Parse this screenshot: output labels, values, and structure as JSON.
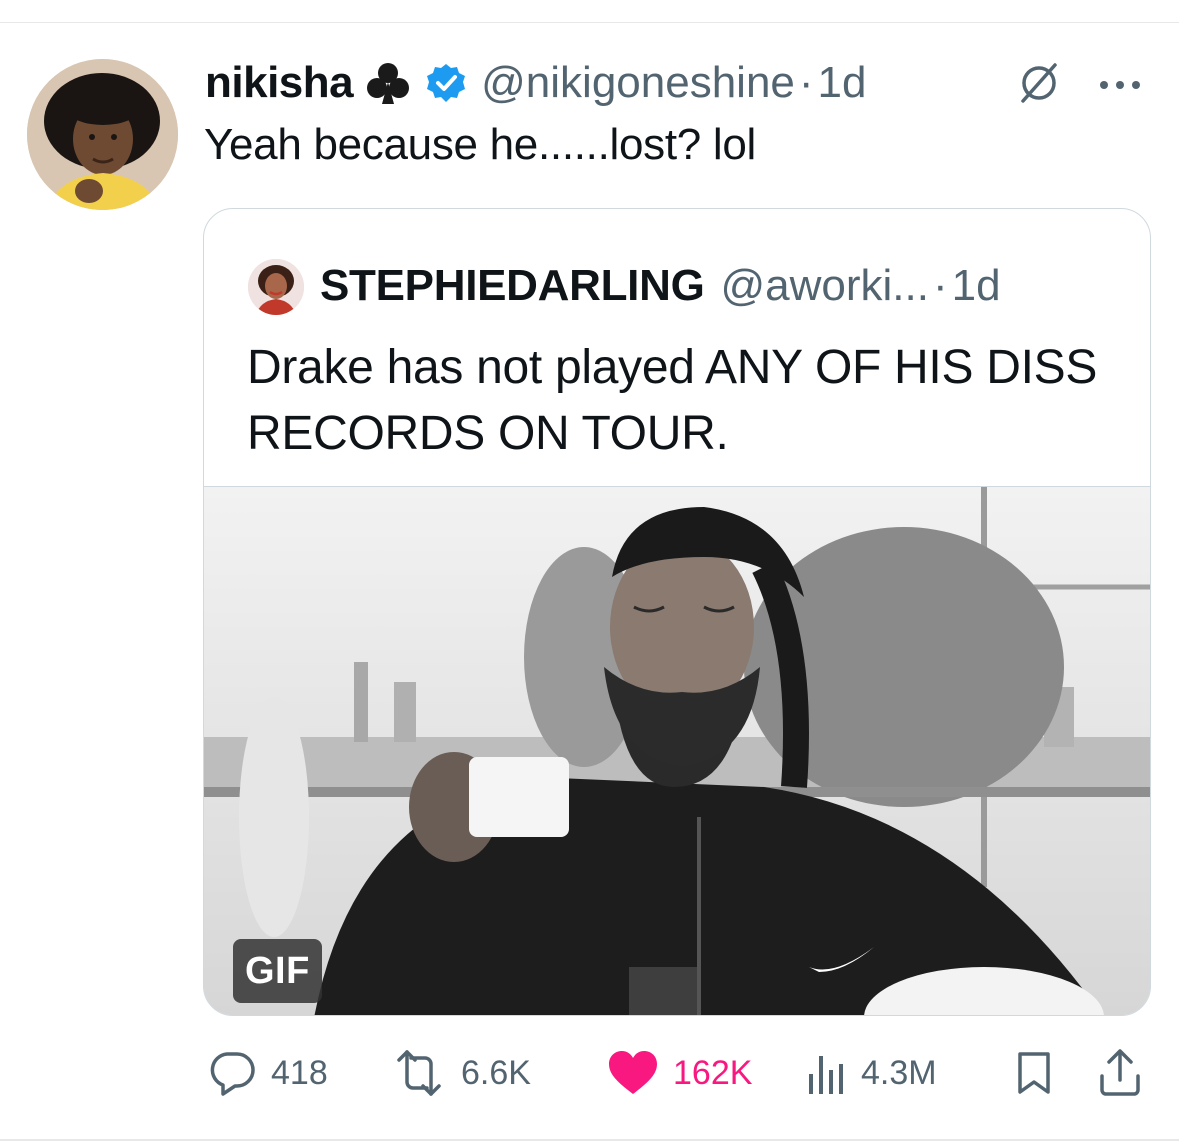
{
  "tweet": {
    "display_name": "nikisha",
    "handle": "@nikigoneshine",
    "separator": "·",
    "time": "1d",
    "text": "Yeah because he......lost? lol",
    "icons": [
      "club-icon",
      "verified-badge-icon",
      "grok-icon",
      "more-icon"
    ]
  },
  "quote": {
    "display_name": "STEPHIEDARLING",
    "handle": "@aworki...",
    "separator": "·",
    "time": "1d",
    "text": "Drake has not played ANY OF HIS DISS RECORDS ON TOUR.",
    "media_badge": "GIF"
  },
  "actions": {
    "replies": "418",
    "reposts": "6.6K",
    "likes": "162K",
    "views": "4.3M"
  },
  "colors": {
    "secondary_text": "#536471",
    "verified_blue": "#1d9bf0",
    "like_pink": "#f91880",
    "border": "#cfd9de"
  }
}
